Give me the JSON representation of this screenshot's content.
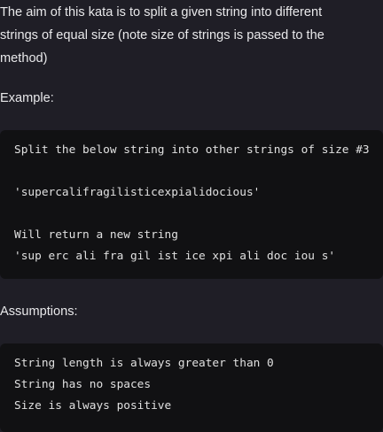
{
  "description": {
    "lines": [
      "The aim of this kata is to split a given string into different",
      "strings of equal size (note size of strings is passed to the",
      "method)"
    ]
  },
  "example_heading": "Example:",
  "example_code": [
    "Split the below string into other strings of size #3",
    "'supercalifragilisticexpialidocious'",
    "Will return a new string",
    "'sup erc ali fra gil ist ice xpi ali doc iou s'"
  ],
  "assumptions_heading": "Assumptions:",
  "assumptions_code": [
    "String length is always greater than 0",
    "String has no spaces",
    "Size is always positive"
  ]
}
